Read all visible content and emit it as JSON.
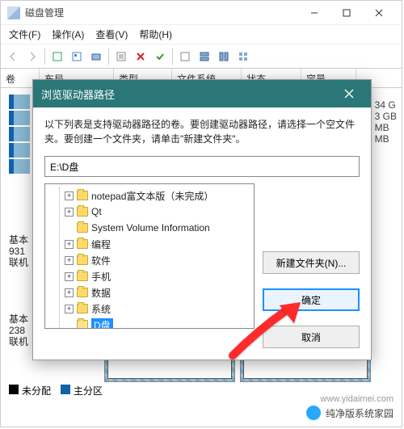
{
  "window": {
    "title": "磁盘管理",
    "menu": {
      "file": "文件(F)",
      "action": "操作(A)",
      "view": "查看(V)",
      "help": "帮助(H)"
    }
  },
  "grid": {
    "h1": "卷",
    "h2": "布局",
    "h3": "类型",
    "h4": "文件系统",
    "h5": "状态",
    "h6": "容量"
  },
  "side": {
    "l1": "34 G",
    "l2": "3 GB",
    "l3": "MB",
    "l4": "MB"
  },
  "disks": {
    "d0a": "基本",
    "d0b": "931",
    "d0c": "联机",
    "d1a": "基本",
    "d1b": "238",
    "d1c": "联机"
  },
  "legend": {
    "a": "未分配",
    "b": "主分区"
  },
  "watermark": {
    "text": "纯净版系统家园",
    "url": "www.yidaimei.com"
  },
  "dialog": {
    "title": "浏览驱动器路径",
    "instr": "以下列表是支持驱动器路径的卷。要创建驱动器路径，请选择一个空文件夹。要创建一个文件夹，请单击\"新建文件夹\"。",
    "path": "E:\\D盘",
    "tree": {
      "i0": "notepad富文本版（未完成）",
      "i1": "Qt",
      "i2": "System Volume Information",
      "i3": "编程",
      "i4": "软件",
      "i5": "手机",
      "i6": "数据",
      "i7": "系统",
      "i8": "D盘"
    },
    "buttons": {
      "newfolder": "新建文件夹(N)...",
      "ok": "确定",
      "cancel": "取消"
    }
  }
}
